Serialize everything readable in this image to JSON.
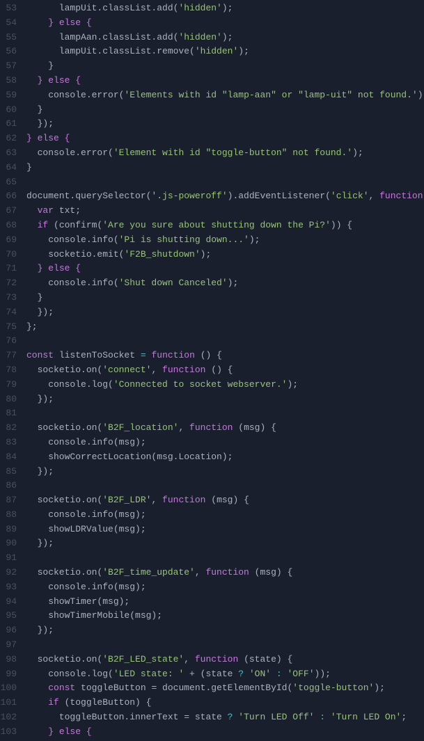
{
  "editor": {
    "background": "#1a1f2e",
    "lines": [
      {
        "num": 53,
        "indent": 3,
        "tokens": [
          {
            "t": "plain",
            "v": "lampUit.classList.add("
          },
          {
            "t": "str",
            "v": "'hidden'"
          },
          {
            "t": "plain",
            "v": "};"
          }
        ]
      },
      {
        "num": 54,
        "indent": 2,
        "tokens": [
          {
            "t": "kw",
            "v": "} else {"
          }
        ]
      },
      {
        "num": 55,
        "indent": 3,
        "tokens": [
          {
            "t": "plain",
            "v": "lampAan.classList.add("
          },
          {
            "t": "str",
            "v": "'hidden'"
          },
          {
            "t": "plain",
            "v": "};"
          }
        ]
      },
      {
        "num": 56,
        "indent": 3,
        "tokens": [
          {
            "t": "plain",
            "v": "lampUit.classList.remove("
          },
          {
            "t": "str",
            "v": "'hidden'"
          },
          {
            "t": "plain",
            "v": "};"
          }
        ]
      },
      {
        "num": 57,
        "indent": 2,
        "tokens": [
          {
            "t": "plain",
            "v": "}"
          }
        ]
      },
      {
        "num": 58,
        "indent": 1,
        "tokens": [
          {
            "t": "kw",
            "v": "} else {"
          }
        ]
      },
      {
        "num": 59,
        "indent": 2,
        "tokens": [
          {
            "t": "plain",
            "v": "console.error("
          },
          {
            "t": "str",
            "v": "'Elements with id \"lamp-aan\" or \"lamp-uit\" not found.'"
          },
          {
            "t": "plain",
            "v": "};"
          }
        ]
      },
      {
        "num": 60,
        "indent": 1,
        "tokens": [
          {
            "t": "plain",
            "v": "}"
          }
        ]
      },
      {
        "num": 61,
        "indent": 0,
        "tokens": [
          {
            "t": "plain",
            "v": "  });"
          }
        ]
      },
      {
        "num": 62,
        "indent": 0,
        "tokens": [
          {
            "t": "kw",
            "v": "} else {"
          }
        ]
      },
      {
        "num": 63,
        "indent": 1,
        "tokens": [
          {
            "t": "plain",
            "v": "console.error("
          },
          {
            "t": "str",
            "v": "'Element with id \"toggle-button\" not found.'"
          },
          {
            "t": "plain",
            "v": "};"
          }
        ]
      },
      {
        "num": 64,
        "indent": 0,
        "tokens": [
          {
            "t": "plain",
            "v": "}"
          }
        ]
      },
      {
        "num": 65,
        "indent": 0,
        "tokens": []
      },
      {
        "num": 66,
        "indent": 0,
        "tokens": [
          {
            "t": "plain",
            "v": "document.querySelector("
          },
          {
            "t": "str",
            "v": "'.js-poweroff'"
          },
          {
            "t": "plain",
            "v": ").addEventListener("
          },
          {
            "t": "str",
            "v": "'click'"
          },
          {
            "t": "plain",
            "v": ", "
          },
          {
            "t": "kw",
            "v": "function"
          },
          {
            "t": "plain",
            "v": " () {"
          }
        ]
      },
      {
        "num": 67,
        "indent": 1,
        "tokens": [
          {
            "t": "kw",
            "v": "var"
          },
          {
            "t": "plain",
            "v": " txt;"
          }
        ]
      },
      {
        "num": 68,
        "indent": 1,
        "tokens": [
          {
            "t": "kw",
            "v": "if"
          },
          {
            "t": "plain",
            "v": " (confirm("
          },
          {
            "t": "str",
            "v": "'Are you sure about shutting down the Pi?'"
          },
          {
            "t": "plain",
            "v": ")) {"
          }
        ]
      },
      {
        "num": 69,
        "indent": 2,
        "tokens": [
          {
            "t": "plain",
            "v": "console.info("
          },
          {
            "t": "str",
            "v": "'Pi is shutting down...'"
          },
          {
            "t": "plain",
            "v": "};"
          }
        ]
      },
      {
        "num": 70,
        "indent": 2,
        "tokens": [
          {
            "t": "plain",
            "v": "socketio.emit("
          },
          {
            "t": "str",
            "v": "'F2B_shutdown'"
          },
          {
            "t": "plain",
            "v": "};"
          }
        ]
      },
      {
        "num": 71,
        "indent": 1,
        "tokens": [
          {
            "t": "kw",
            "v": "} else {"
          }
        ]
      },
      {
        "num": 72,
        "indent": 2,
        "tokens": [
          {
            "t": "plain",
            "v": "console.info("
          },
          {
            "t": "str",
            "v": "'Shut down Canceled'"
          },
          {
            "t": "plain",
            "v": "};"
          }
        ]
      },
      {
        "num": 73,
        "indent": 1,
        "tokens": [
          {
            "t": "plain",
            "v": "}"
          }
        ]
      },
      {
        "num": 74,
        "indent": 0,
        "tokens": [
          {
            "t": "plain",
            "v": "  });"
          }
        ]
      },
      {
        "num": 75,
        "indent": 0,
        "tokens": [
          {
            "t": "plain",
            "v": "};"
          }
        ]
      },
      {
        "num": 76,
        "indent": 0,
        "tokens": []
      },
      {
        "num": 77,
        "indent": 0,
        "tokens": [
          {
            "t": "kw",
            "v": "const"
          },
          {
            "t": "plain",
            "v": " listenToSocket "
          },
          {
            "t": "op",
            "v": "="
          },
          {
            "t": "plain",
            "v": " "
          },
          {
            "t": "kw",
            "v": "function"
          },
          {
            "t": "plain",
            "v": " () {"
          }
        ]
      },
      {
        "num": 78,
        "indent": 1,
        "tokens": [
          {
            "t": "plain",
            "v": "socketio.on("
          },
          {
            "t": "str",
            "v": "'connect'"
          },
          {
            "t": "plain",
            "v": ", "
          },
          {
            "t": "kw",
            "v": "function"
          },
          {
            "t": "plain",
            "v": " () {"
          }
        ]
      },
      {
        "num": 79,
        "indent": 2,
        "tokens": [
          {
            "t": "plain",
            "v": "console.log("
          },
          {
            "t": "str",
            "v": "'Connected to socket webserver.'"
          },
          {
            "t": "plain",
            "v": "};"
          }
        ]
      },
      {
        "num": 80,
        "indent": 1,
        "tokens": [
          {
            "t": "plain",
            "v": "  });"
          }
        ]
      },
      {
        "num": 81,
        "indent": 0,
        "tokens": []
      },
      {
        "num": 82,
        "indent": 1,
        "tokens": [
          {
            "t": "plain",
            "v": "socketio.on("
          },
          {
            "t": "str",
            "v": "'B2F_location'"
          },
          {
            "t": "plain",
            "v": ", "
          },
          {
            "t": "kw",
            "v": "function"
          },
          {
            "t": "plain",
            "v": " (msg) {"
          }
        ]
      },
      {
        "num": 83,
        "indent": 2,
        "tokens": [
          {
            "t": "plain",
            "v": "console.info(msg);"
          }
        ]
      },
      {
        "num": 84,
        "indent": 2,
        "tokens": [
          {
            "t": "plain",
            "v": "showCorrectLocation(msg.Location);"
          }
        ]
      },
      {
        "num": 85,
        "indent": 1,
        "tokens": [
          {
            "t": "plain",
            "v": "  });"
          }
        ]
      },
      {
        "num": 86,
        "indent": 0,
        "tokens": []
      },
      {
        "num": 87,
        "indent": 1,
        "tokens": [
          {
            "t": "plain",
            "v": "socketio.on("
          },
          {
            "t": "str",
            "v": "'B2F_LDR'"
          },
          {
            "t": "plain",
            "v": ", "
          },
          {
            "t": "kw",
            "v": "function"
          },
          {
            "t": "plain",
            "v": " (msg) {"
          }
        ]
      },
      {
        "num": 88,
        "indent": 2,
        "tokens": [
          {
            "t": "plain",
            "v": "console.info(msg);"
          }
        ]
      },
      {
        "num": 89,
        "indent": 2,
        "tokens": [
          {
            "t": "plain",
            "v": "showLDRValue(msg);"
          }
        ]
      },
      {
        "num": 90,
        "indent": 1,
        "tokens": [
          {
            "t": "plain",
            "v": "  });"
          }
        ]
      },
      {
        "num": 91,
        "indent": 0,
        "tokens": []
      },
      {
        "num": 92,
        "indent": 1,
        "tokens": [
          {
            "t": "plain",
            "v": "socketio.on("
          },
          {
            "t": "str",
            "v": "'B2F_time_update'"
          },
          {
            "t": "plain",
            "v": ", "
          },
          {
            "t": "kw",
            "v": "function"
          },
          {
            "t": "plain",
            "v": " (msg) {"
          }
        ]
      },
      {
        "num": 93,
        "indent": 2,
        "tokens": [
          {
            "t": "plain",
            "v": "console.info(msg);"
          }
        ]
      },
      {
        "num": 94,
        "indent": 2,
        "tokens": [
          {
            "t": "plain",
            "v": "showTimer(msg);"
          }
        ]
      },
      {
        "num": 95,
        "indent": 2,
        "tokens": [
          {
            "t": "plain",
            "v": "showTimerMobile(msg);"
          }
        ]
      },
      {
        "num": 96,
        "indent": 1,
        "tokens": [
          {
            "t": "plain",
            "v": "  });"
          }
        ]
      },
      {
        "num": 97,
        "indent": 0,
        "tokens": []
      },
      {
        "num": 98,
        "indent": 1,
        "tokens": [
          {
            "t": "plain",
            "v": "socketio.on("
          },
          {
            "t": "str",
            "v": "'B2F_LED_state'"
          },
          {
            "t": "plain",
            "v": ", "
          },
          {
            "t": "kw",
            "v": "function"
          },
          {
            "t": "plain",
            "v": " (state) {"
          }
        ]
      },
      {
        "num": 99,
        "indent": 2,
        "tokens": [
          {
            "t": "plain",
            "v": "console.log("
          },
          {
            "t": "str",
            "v": "'LED state: '"
          },
          {
            "t": "plain",
            "v": " + (state "
          },
          {
            "t": "op",
            "v": "?"
          },
          {
            "t": "str",
            "v": "'ON'"
          },
          {
            "t": "op",
            "v": " : "
          },
          {
            "t": "str",
            "v": "'OFF'"
          },
          {
            "t": "plain",
            "v": "));"
          }
        ]
      },
      {
        "num": 100,
        "indent": 2,
        "tokens": [
          {
            "t": "kw",
            "v": "const"
          },
          {
            "t": "plain",
            "v": " toggleButton = document.getElementById("
          },
          {
            "t": "str",
            "v": "'toggle-button'"
          },
          {
            "t": "plain",
            "v": "};"
          }
        ]
      },
      {
        "num": 101,
        "indent": 2,
        "tokens": [
          {
            "t": "kw",
            "v": "if"
          },
          {
            "t": "plain",
            "v": " (toggleButton) {"
          }
        ]
      },
      {
        "num": 102,
        "indent": 3,
        "tokens": [
          {
            "t": "plain",
            "v": "toggleButton.innerText = state "
          },
          {
            "t": "op",
            "v": "?"
          },
          {
            "t": "str",
            "v": " 'Turn LED Off'"
          },
          {
            "t": "op",
            "v": " : "
          },
          {
            "t": "str",
            "v": "'Turn LED On'"
          },
          {
            "t": "plain",
            "v": ";"
          }
        ]
      },
      {
        "num": 103,
        "indent": 2,
        "tokens": [
          {
            "t": "kw",
            "v": "} else {"
          }
        ]
      }
    ]
  }
}
